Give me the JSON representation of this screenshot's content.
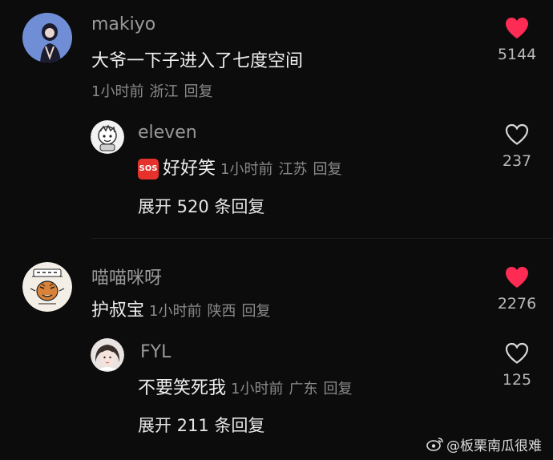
{
  "comments": [
    {
      "username": "makiyo",
      "text": "大爷一下子进入了七度空间",
      "time": "1小时前",
      "location": "浙江",
      "reply_label": "回复",
      "likes": "5144",
      "liked": true,
      "replies": [
        {
          "username": "eleven",
          "emoji": "SOS",
          "text": "好好笑",
          "time": "1小时前",
          "location": "江苏",
          "reply_label": "回复",
          "likes": "237",
          "liked": false
        }
      ],
      "expand_label": "展开 520 条回复"
    },
    {
      "username": "喵喵咪呀",
      "text": "护叔宝",
      "time": "1小时前",
      "location": "陕西",
      "reply_label": "回复",
      "likes": "2276",
      "liked": true,
      "replies": [
        {
          "username": "FYL",
          "text": "不要笑死我",
          "time": "1小时前",
          "location": "广东",
          "reply_label": "回复",
          "likes": "125",
          "liked": false
        }
      ],
      "expand_label": "展开 211 条回复"
    }
  ],
  "watermark": "@板栗南瓜很难",
  "colors": {
    "background": "#0c0c0c",
    "liked_heart": "#fe2c55",
    "username": "#9a9a9a",
    "meta": "#8a8a8a"
  }
}
